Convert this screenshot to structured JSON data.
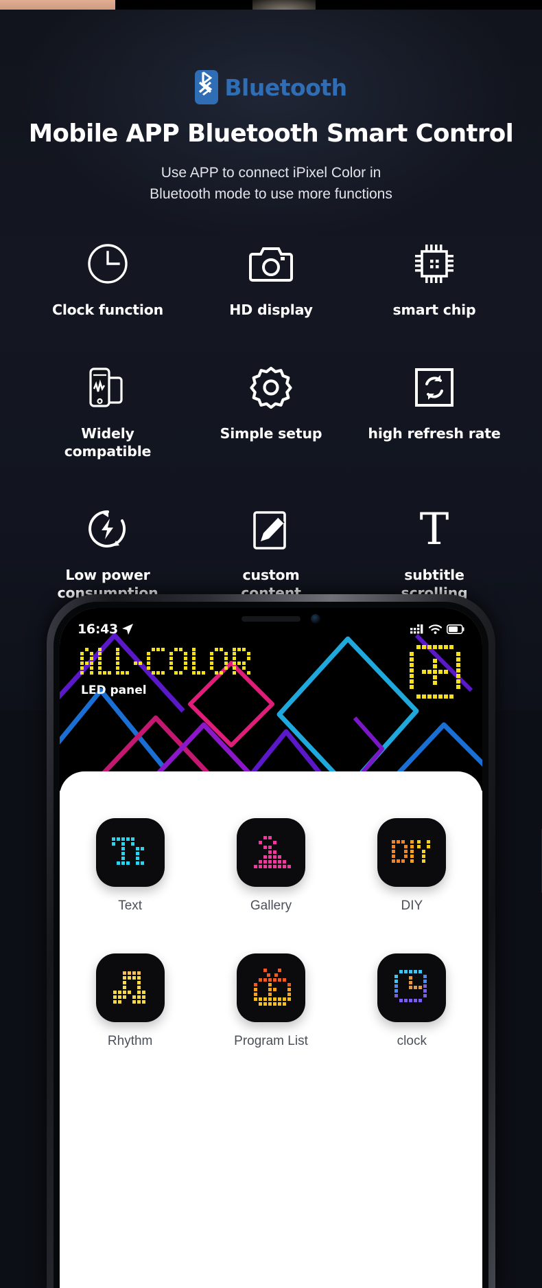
{
  "hero": {
    "bluetooth_word": "Bluetooth",
    "bluetooth_icon": "bluetooth-icon",
    "title": "Mobile APP Bluetooth Smart Control",
    "subtitle_line1": "Use APP to connect iPixel Color in",
    "subtitle_line2": "Bluetooth mode to use more functions",
    "bluetooth_color": "#2f6db5",
    "background_color": "#11141c"
  },
  "features": [
    {
      "icon": "clock-icon",
      "label": "Clock function"
    },
    {
      "icon": "camera-icon",
      "label": "HD display"
    },
    {
      "icon": "chip-icon",
      "label": "smart chip"
    },
    {
      "icon": "devices-icon",
      "label": "Widely\ncompatible"
    },
    {
      "icon": "gear-icon",
      "label": "Simple setup"
    },
    {
      "icon": "refresh-square-icon",
      "label": "high refresh rate"
    },
    {
      "icon": "low-power-icon",
      "label": "Low power\nconsumption"
    },
    {
      "icon": "pencil-square-icon",
      "label": "custom\ncontent"
    },
    {
      "icon": "text-t-icon",
      "label": "subtitle\nscrolling"
    }
  ],
  "phone": {
    "status_bar": {
      "time": "16:43",
      "location_icon": "location-arrow-icon",
      "signal_icon": "signal-bars-icon",
      "wifi_icon": "wifi-icon",
      "battery_icon": "battery-icon"
    },
    "app_header": {
      "brand": "ALL-COLOR",
      "subtitle": "LED panel",
      "add_button_icon": "plus-pixel-icon",
      "brand_color": "#f5e01c"
    },
    "tiles": [
      {
        "icon": "pixel-text-icon",
        "label": "Text",
        "color": "#2ad4f0"
      },
      {
        "icon": "pixel-gallery-icon",
        "label": "Gallery",
        "color": "#f0399c"
      },
      {
        "icon": "pixel-diy-icon",
        "label": "DIY",
        "color": "#f58220"
      },
      {
        "icon": "pixel-music-icon",
        "label": "Rhythm",
        "color": "#f5d94a"
      },
      {
        "icon": "pixel-program-icon",
        "label": "Program List",
        "color": "#f58220"
      },
      {
        "icon": "pixel-clock-icon",
        "label": "clock",
        "color": "#4b8df8"
      }
    ]
  }
}
